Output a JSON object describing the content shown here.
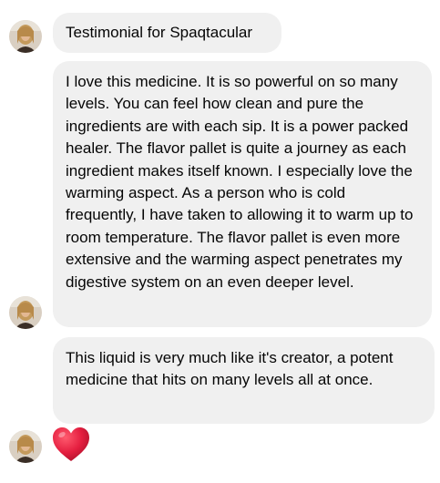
{
  "messages": [
    {
      "text": "Testimonial for Spaqtacular"
    },
    {
      "text": "I love this medicine. It is so powerful on so many levels. You can feel how clean and pure the ingredients are with each sip. It is a power packed healer. The flavor pallet is quite a journey as each ingredient makes itself known. I especially love the warming aspect. As a person who is cold frequently, I have taken to allowing it to warm up to room temperature. The flavor pallet is even more extensive and the warming aspect penetrates my digestive system on an even deeper level."
    },
    {
      "text": "This liquid is very much like it's creator, a potent medicine that hits on many levels all at once."
    }
  ],
  "reaction": {
    "icon": "heart-icon",
    "color": "#e41e3f"
  },
  "colors": {
    "bubble_bg": "#f0f0f0",
    "text": "#050505"
  }
}
